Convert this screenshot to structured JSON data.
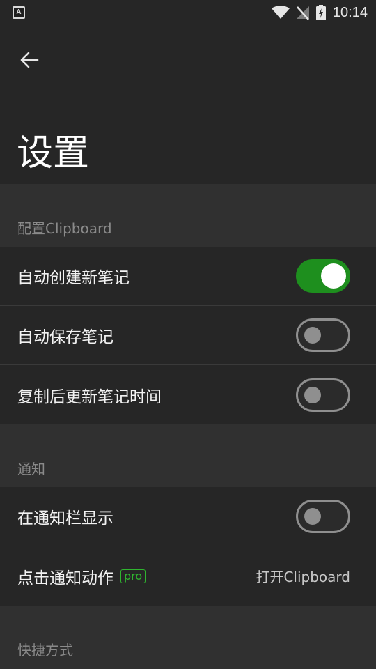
{
  "status_bar": {
    "left_icon_letter": "A",
    "time": "10:14"
  },
  "header": {
    "title": "设置"
  },
  "sections": [
    {
      "title": "配置Clipboard",
      "rows": [
        {
          "label": "自动创建新笔记",
          "toggle": true
        },
        {
          "label": "自动保存笔记",
          "toggle": false
        },
        {
          "label": "复制后更新笔记时间",
          "toggle": false
        }
      ]
    },
    {
      "title": "通知",
      "rows": [
        {
          "label": "在通知栏显示",
          "toggle": false
        },
        {
          "label": "点击通知动作",
          "badge": "pro",
          "value": "打开Clipboard"
        }
      ]
    },
    {
      "title": "快捷方式"
    }
  ],
  "colors": {
    "accent": "#1e8f1e",
    "pro_badge": "#2fb52f",
    "background": "#303030",
    "row_background": "#262626"
  }
}
